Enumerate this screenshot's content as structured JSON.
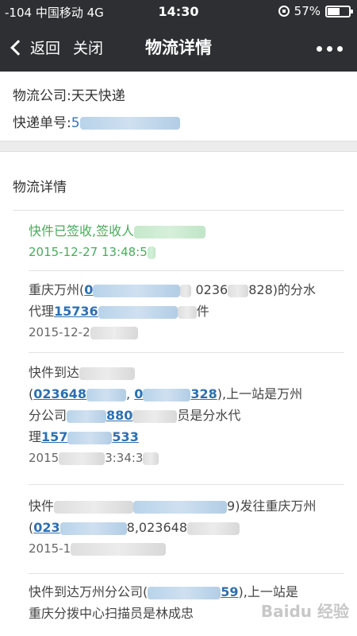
{
  "status_bar": {
    "signal": "-104",
    "carrier": "中国移动",
    "network": "4G",
    "time": "14:30",
    "battery": "57%",
    "battery_fraction": 0.57
  },
  "navbar": {
    "back_label": "返回",
    "close_label": "关闭",
    "title": "物流详情"
  },
  "company": {
    "company_label": "物流公司:",
    "company_name": "天天快递",
    "waybill_label": "快递单号:",
    "waybill_visible": "5"
  },
  "details": {
    "title": "物流详情",
    "entries": [
      {
        "line1": "快件已签收,签收人",
        "time": "2015-12-27 13:48:5"
      },
      {
        "line1_a": "重庆万州(",
        "line1_b": "0",
        "line1_c": "0236",
        "line1_d": "828)的分水",
        "line2_a": "代理",
        "line2_phone": "15736",
        "line2_b": "件",
        "time": "2015-12-2"
      },
      {
        "line1": "快件到达",
        "line2_a": "(",
        "line2_phone1": "023648",
        "line2_mid": "0",
        "line2_phone2": "328",
        "line2_b": "),上一站是万州",
        "line3_a": "分公司",
        "line3_phone": "880",
        "line3_b": "员是分水代",
        "line4_a": "理",
        "line4_phone": "157",
        "line4_phone2": "533",
        "time_a": "2015",
        "time_b": "3:34:3"
      },
      {
        "line1_a": "快件",
        "line1_b": "9)发往重庆万州",
        "line2_a": "(",
        "line2_phone": "023",
        "line2_b": "8,",
        "line2_c": "023648",
        "time": "2015-1"
      },
      {
        "line1_a": "快件到达万州分公司(",
        "line1_phone": "59",
        "line1_b": "),上一站是",
        "line2": "重庆分拨中心扫描员是林成忠"
      }
    ]
  },
  "watermark": "Baidu 经验"
}
